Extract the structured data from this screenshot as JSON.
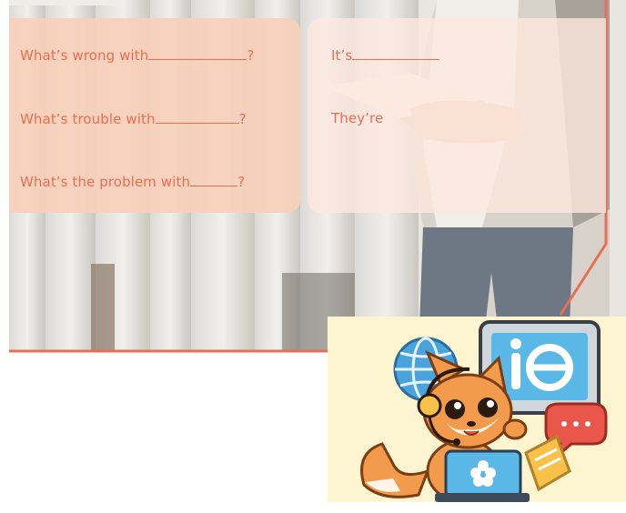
{
  "left_panel": {
    "lines": [
      {
        "text": "What’s wrong with",
        "qmark": "?"
      },
      {
        "text": "What’s trouble with",
        "qmark": "?"
      },
      {
        "text": "What’s the problem with",
        "qmark": "?"
      }
    ]
  },
  "right_panel": {
    "lines": [
      {
        "text": "It’s"
      },
      {
        "text": "They’re"
      }
    ]
  },
  "colors": {
    "accent": "#e86f54",
    "left_panel_bg": "#f8d0ba",
    "right_panel_bg": "#fce8de",
    "mascot_bg": "#fdf5cf"
  },
  "icons": [
    "globe-icon",
    "monitor-e-icon",
    "chat-bubble-icon",
    "laptop-flower-icon",
    "headset-icon"
  ]
}
